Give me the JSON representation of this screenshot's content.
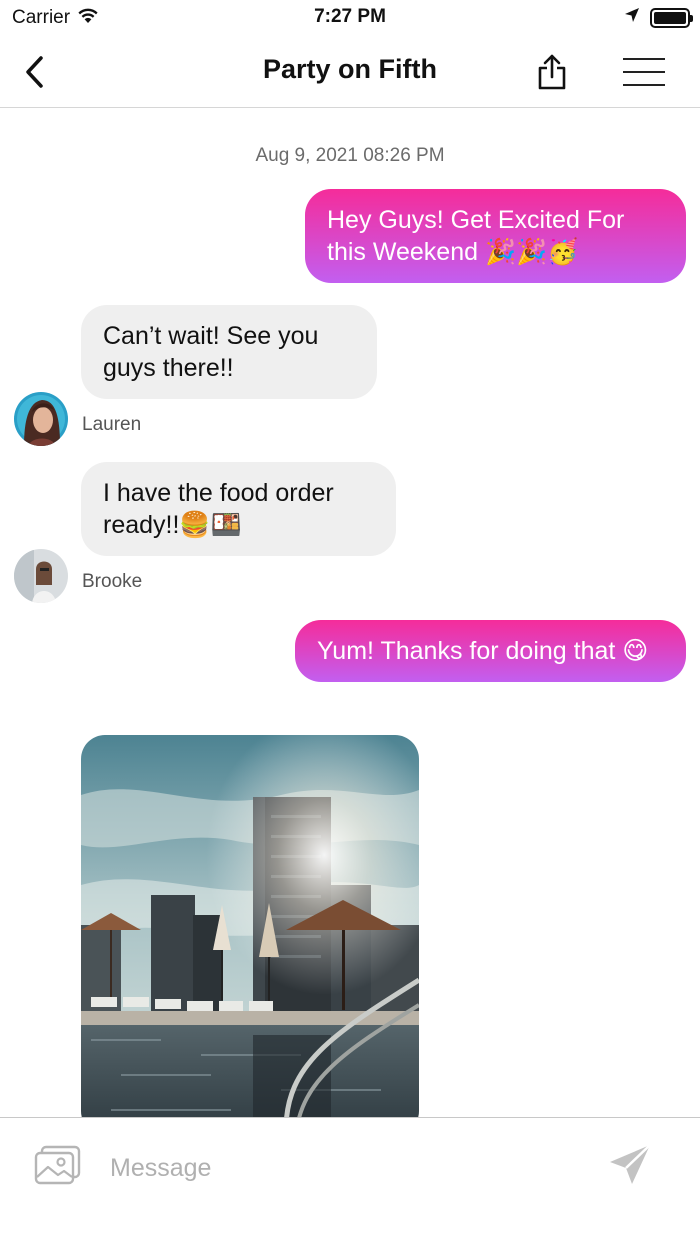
{
  "status_bar": {
    "carrier": "Carrier",
    "time": "7:27 PM"
  },
  "header": {
    "title": "Party on Fifth"
  },
  "conversation": {
    "timestamp": "Aug 9, 2021 08:26 PM",
    "messages": [
      {
        "direction": "outgoing",
        "text": "Hey Guys! Get Excited For this Weekend 🎉🎉🥳"
      },
      {
        "direction": "incoming",
        "sender": "Lauren",
        "text": "Can’t wait! See you guys there!!"
      },
      {
        "direction": "incoming",
        "sender": "Brooke",
        "text": "I have the food order ready!!🍔🍱"
      },
      {
        "direction": "outgoing",
        "text": "Yum! Thanks for doing that 😋"
      },
      {
        "direction": "incoming",
        "type": "photo"
      }
    ]
  },
  "composer": {
    "placeholder": "Message"
  },
  "colors": {
    "outgoing_gradient_start": "#f52c9a",
    "outgoing_gradient_end": "#c25ff0",
    "incoming_bubble": "#efefef",
    "placeholder": "#b0b0b0"
  },
  "icons": {
    "back": "chevron-left-icon",
    "share": "share-icon",
    "menu": "hamburger-menu-icon",
    "gallery": "photo-gallery-icon",
    "send": "paper-plane-icon"
  }
}
